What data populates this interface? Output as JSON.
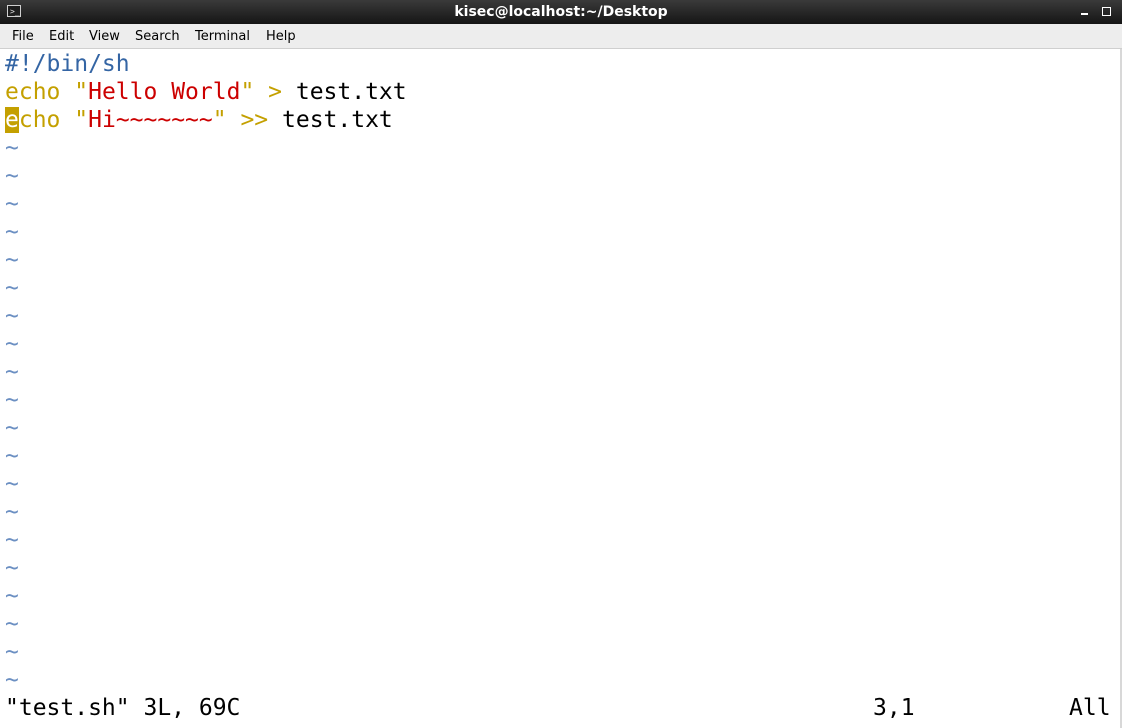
{
  "window": {
    "title": "kisec@localhost:~/Desktop",
    "icon": "terminal-icon"
  },
  "menu": {
    "items": [
      "File",
      "Edit",
      "View",
      "Search",
      "Terminal",
      "Help"
    ]
  },
  "editor": {
    "line1": {
      "text": "#!/bin/sh"
    },
    "line2": {
      "kw": "echo",
      "sp1": " ",
      "q_open": "\"",
      "str": "Hello World",
      "q_close": "\"",
      "op": " > ",
      "rest": "test.txt"
    },
    "line3": {
      "cursor_char": "e",
      "kw_rest": "cho",
      "sp1": " ",
      "q_open": "\"",
      "str": "Hi~~~~~~~",
      "q_close": "\"",
      "op": " >> ",
      "rest": "test.txt"
    },
    "tilde": "~"
  },
  "status": {
    "file_info": "\"test.sh\" 3L, 69C",
    "position": "3,1",
    "scroll": "All"
  },
  "colors": {
    "comment": "#3465a4",
    "keyword": "#c4a000",
    "string": "#cc0000",
    "tilde": "#6b8fc2"
  }
}
